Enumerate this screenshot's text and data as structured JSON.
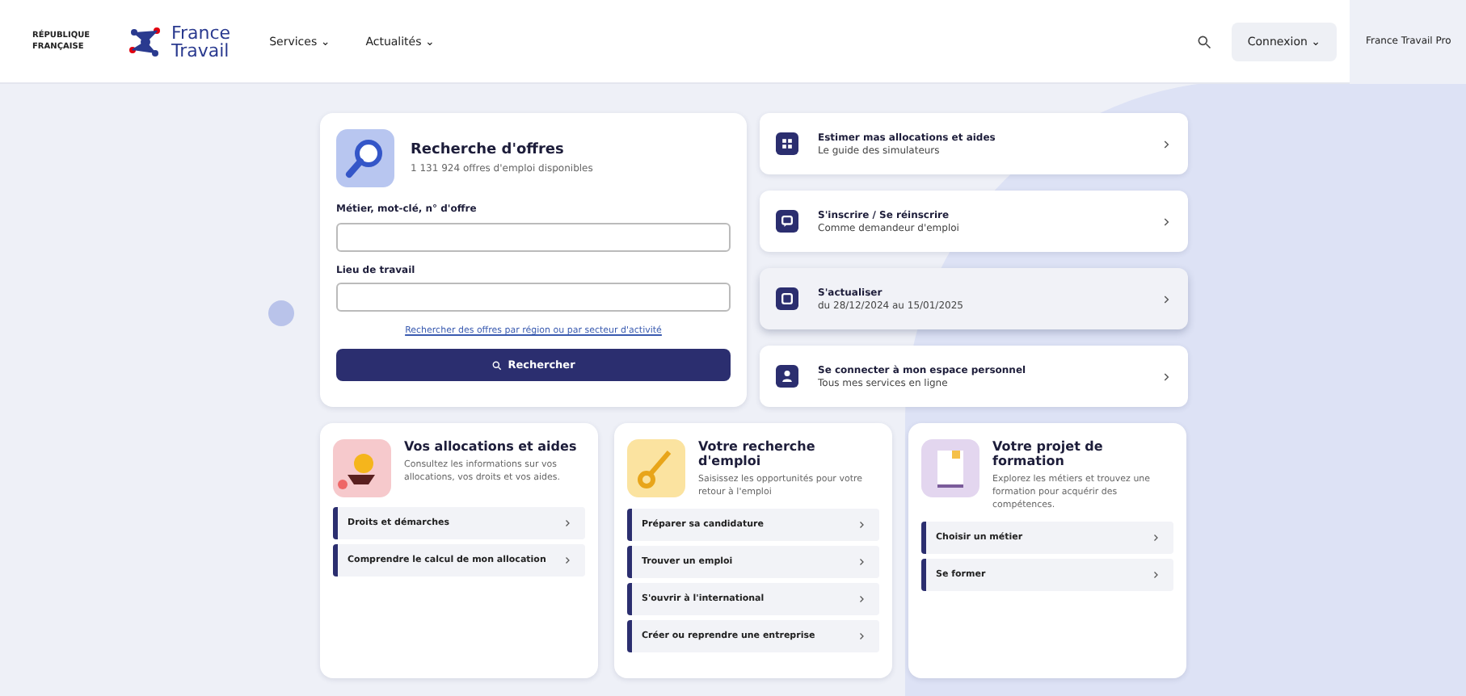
{
  "header": {
    "republic_label": "RÉPUBLIQUE FRANÇAISE",
    "logo_text": [
      "France",
      "Travail"
    ],
    "nav": [
      {
        "label": "Services",
        "caret": "⌄"
      },
      {
        "label": "Actualités",
        "caret": "⌄"
      }
    ],
    "login": {
      "label": "Connexion",
      "caret": "⌄"
    },
    "pro_link": "France Travail Pro"
  },
  "search_card": {
    "title": "Recherche d'offres",
    "subtitle": "1 131 924 offres d'emploi disponibles",
    "fields": [
      {
        "label": "Métier, mot-clé, n° d'offre"
      },
      {
        "label": "Lieu de travail"
      }
    ],
    "link": "Rechercher des offres par région ou par secteur d'activité",
    "button": "Rechercher"
  },
  "quick_links": [
    {
      "title": "Estimer mas allocations et aides",
      "subtitle": "Le guide des simulateurs",
      "highlighted": false
    },
    {
      "title": "S'inscrire / Se réinscrire",
      "subtitle": "Comme demandeur d'emploi",
      "highlighted": false
    },
    {
      "title": "S'actualiser",
      "subtitle": "du 28/12/2024 au 15/01/2025",
      "highlighted": true
    },
    {
      "title": "Se connecter à mon espace personnel",
      "subtitle": "Tous mes services en ligne",
      "highlighted": false
    }
  ],
  "topic_cards": [
    {
      "title": "Vos allocations et aides",
      "text": "Consultez les informations sur vos allocations, vos droits et vos aides.",
      "color": "#f6c9cc",
      "links": [
        "Droits et démarches",
        "Comprendre le calcul de mon allocation"
      ]
    },
    {
      "title": "Votre recherche d'emploi",
      "text": "Saisissez les opportunités pour votre retour à l'emploi",
      "color": "#fbe3a0",
      "links": [
        "Préparer sa candidature",
        "Trouver un emploi",
        "S'ouvrir à l'international",
        "Créer ou reprendre une entreprise"
      ]
    },
    {
      "title": "Votre projet de formation",
      "text": "Explorez les métiers et trouvez une formation pour acquérir des compétences.",
      "color": "#e3d6ef",
      "links": [
        "Choisir un métier",
        "Se former"
      ]
    }
  ]
}
